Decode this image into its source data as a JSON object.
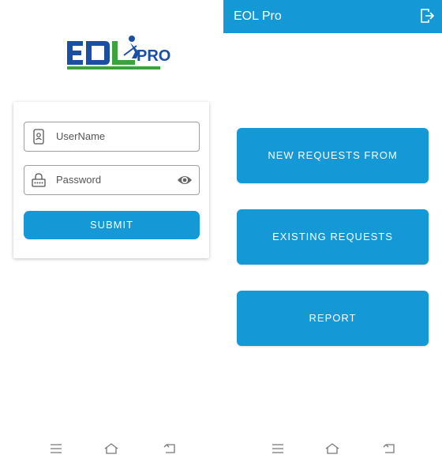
{
  "login": {
    "logo_text": "EOL PRO",
    "username_placeholder": "UserName",
    "password_placeholder": "Password",
    "submit_label": "SUBMIT"
  },
  "main": {
    "title": "EOL Pro",
    "buttons": [
      {
        "label": "NEW REQUESTS FROM LANDLORD"
      },
      {
        "label": "EXISTING REQUESTS"
      },
      {
        "label": "REPORT"
      }
    ]
  },
  "colors": {
    "accent": "#1599d6",
    "logo_blue": "#1b4fa3",
    "logo_green": "#3aa33b"
  },
  "icons": [
    "user-id-icon",
    "password-icon",
    "eye-icon",
    "logout-icon",
    "menu-icon",
    "home-icon",
    "back-icon"
  ]
}
